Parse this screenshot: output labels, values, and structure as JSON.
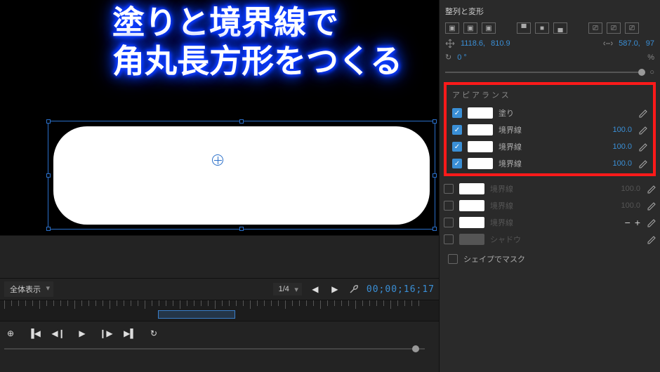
{
  "overlay": {
    "line1": "塗りと境界線で",
    "line2": "角丸長方形をつくる"
  },
  "timeline": {
    "view_mode": "全体表示",
    "resolution": "1/4",
    "timecode": "00;00;16;17"
  },
  "panel": {
    "align_title": "整列と変形",
    "pos_x": "1118.6,",
    "pos_y": "810.9",
    "size_x": "587.0,",
    "size_y": "97",
    "rotation": "0 °",
    "opacity_pct": "%",
    "appearance_title": "アピアランス",
    "rows": [
      {
        "checked": true,
        "swatch": "white",
        "label": "塗り",
        "value": ""
      },
      {
        "checked": true,
        "swatch": "white",
        "label": "境界線",
        "value": "100.0"
      },
      {
        "checked": true,
        "swatch": "white",
        "label": "境界線",
        "value": "100.0"
      },
      {
        "checked": true,
        "swatch": "white",
        "label": "境界線",
        "value": "100.0"
      }
    ],
    "extra_rows": [
      {
        "checked": false,
        "swatch": "white",
        "label": "境界線",
        "value": "100.0",
        "dim": true
      },
      {
        "checked": false,
        "swatch": "white",
        "label": "境界線",
        "value": "100.0",
        "dim": true
      },
      {
        "checked": false,
        "swatch": "white",
        "label": "境界線",
        "value": "",
        "dim": true,
        "plusminus": true
      },
      {
        "checked": false,
        "swatch": "dim",
        "label": "シャドウ",
        "value": "",
        "dim": true
      }
    ],
    "mask_label": "シェイプでマスク"
  }
}
